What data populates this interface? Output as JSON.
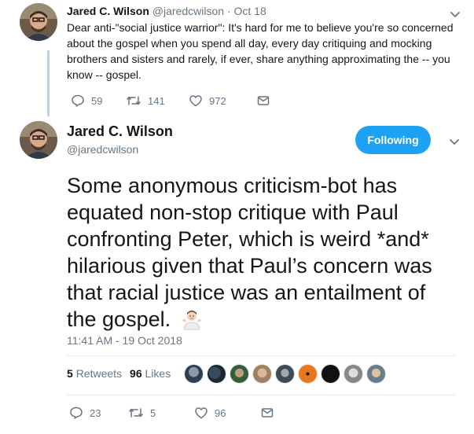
{
  "parent_tweet": {
    "name": "Jared C. Wilson",
    "handle": "@jaredcwilson",
    "date": "Oct 18",
    "separator": "·",
    "text": "Dear anti-\"social justice warrior\": It's hard for me to believe you're so concerned about the gospel when you spend all day, every day critiquing and mocking brothers and sisters and rarely, if ever, share anything approximating the -- you know -- gospel.",
    "replies": "59",
    "retweets": "141",
    "likes": "972",
    "icons": [
      "reply-icon",
      "retweet-icon",
      "like-icon",
      "message-icon",
      "chevron-down-icon"
    ]
  },
  "main_tweet": {
    "name": "Jared C. Wilson",
    "handle": "@jaredcwilson",
    "follow_label": "Following",
    "text": "Some anonymous criticism-bot has equated non-stop critique with Paul confronting Peter, which is weird *and* hilarious given that Paul’s concern was that racial justice was an entailment of the gospel.",
    "emoji": "man-shrugging-emoji",
    "timestamp": "11:41 AM - 19 Oct 2018",
    "retweets_count": "5",
    "retweets_label": "Retweets",
    "likes_count": "96",
    "likes_label": "Likes",
    "liker_avatars": 9,
    "replies": "23",
    "retweets": "5",
    "likes": "96"
  },
  "colors": {
    "accent": "#1da1f2",
    "text": "#14171a",
    "muted": "#657786",
    "divider": "#e6ecf0",
    "thread_line": "#c4cfd6"
  }
}
